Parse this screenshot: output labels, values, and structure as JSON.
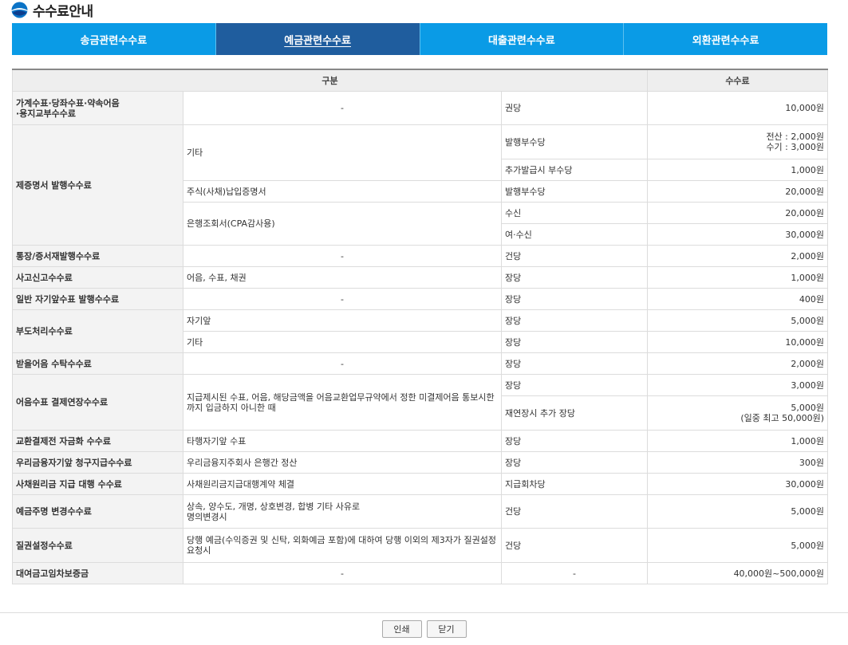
{
  "header": {
    "title": "수수료안내"
  },
  "tabs": [
    {
      "label": "송금관련수수료",
      "active": false
    },
    {
      "label": "예금관련수수료",
      "active": true
    },
    {
      "label": "대출관련수수료",
      "active": false
    },
    {
      "label": "외환관련수수료",
      "active": false
    }
  ],
  "table": {
    "headers": {
      "category": "구분",
      "fee": "수수료"
    },
    "rows": [
      {
        "category": "가계수표·당좌수표·약속어음\n·용지교부수수료",
        "detail": "-",
        "unit": "권당",
        "fee": "10,000원"
      },
      {
        "category": "제증명서 발행수수료",
        "detail": "기타",
        "unit": "발행부수당",
        "fee": "전산 : 2,000원\n수기 : 3,000원"
      },
      {
        "unit": "추가발급시 부수당",
        "fee": "1,000원"
      },
      {
        "detail": "주식(사채)납입증명서",
        "unit": "발행부수당",
        "fee": "20,000원"
      },
      {
        "detail": "은행조회서(CPA감사용)",
        "unit": "수신",
        "fee": "20,000원"
      },
      {
        "unit": "여·수신",
        "fee": "30,000원"
      },
      {
        "category": "통장/증서재발행수수료",
        "detail": "-",
        "unit": "건당",
        "fee": "2,000원"
      },
      {
        "category": "사고신고수수료",
        "detail": "어음, 수표, 채권",
        "unit": "장당",
        "fee": "1,000원"
      },
      {
        "category": "일반 자기앞수표 발행수수료",
        "detail": "-",
        "unit": "장당",
        "fee": "400원"
      },
      {
        "category": "부도처리수수료",
        "detail": "자기앞",
        "unit": "장당",
        "fee": "5,000원"
      },
      {
        "detail": "기타",
        "unit": "장당",
        "fee": "10,000원"
      },
      {
        "category": "받을어음 수탁수수료",
        "detail": "-",
        "unit": "장당",
        "fee": "2,000원"
      },
      {
        "category": "어음수표 결제연장수수료",
        "detail": "지급제시된 수표, 어음, 해당금액을 어음교환업무규약에서 정한 미결제어음 통보시한까지 입금하지 아니한 때",
        "unit": "장당",
        "fee": "3,000원"
      },
      {
        "unit": "재연장시 추가 장당",
        "fee": "5,000원\n(일중 최고 50,000원)"
      },
      {
        "category": "교환결제전 자금화 수수료",
        "detail": "타행자기앞 수표",
        "unit": "장당",
        "fee": "1,000원"
      },
      {
        "category": "우리금융자기앞 청구지급수수료",
        "detail": "우리금융지주회사 은행간 정산",
        "unit": "장당",
        "fee": "300원"
      },
      {
        "category": "사채원리금 지급 대행 수수료",
        "detail": "사채원리금지급대행계약 체결",
        "unit": "지급회차당",
        "fee": "30,000원"
      },
      {
        "category": "예금주명 변경수수료",
        "detail": "상속, 양수도, 개명, 상호변경, 합병 기타 사유로\n명의변경시",
        "unit": "건당",
        "fee": "5,000원"
      },
      {
        "category": "질권설정수수료",
        "detail": "당행 예금(수익증권 및 신탁, 외화예금 포함)에 대하여 당행 이외의 제3자가 질권설정 요청시",
        "unit": "건당",
        "fee": "5,000원"
      },
      {
        "category": "대여금고임차보증금",
        "detail": "-",
        "unit": "-",
        "fee": "40,000원~500,000원"
      }
    ]
  },
  "buttons": {
    "print": "인쇄",
    "close": "닫기"
  },
  "colors": {
    "tab_bg": "#0a9be6",
    "tab_active_bg": "#1f5d9e"
  }
}
